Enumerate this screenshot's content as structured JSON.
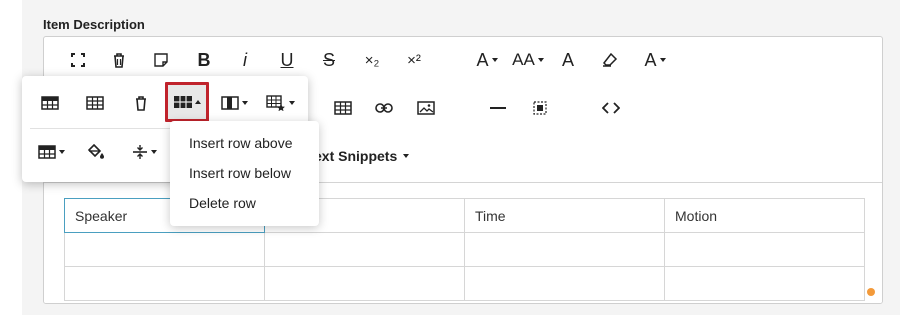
{
  "field": {
    "label": "Item Description"
  },
  "toolbar": {
    "row1": [
      {
        "name": "fullscreen-icon"
      },
      {
        "name": "trash-icon"
      },
      {
        "name": "note-icon"
      },
      {
        "name": "bold-icon",
        "text": "B"
      },
      {
        "name": "italic-icon",
        "text": "i"
      },
      {
        "name": "underline-icon",
        "text": "U"
      },
      {
        "name": "strikethrough-icon",
        "text": "S"
      },
      {
        "name": "subscript-icon",
        "text": "×₂"
      },
      {
        "name": "superscript-icon",
        "text": "×²"
      },
      {
        "name": "font-family-icon",
        "text": "A"
      },
      {
        "name": "font-size-icon",
        "text": "AA"
      },
      {
        "name": "text-color-icon",
        "text": "A"
      },
      {
        "name": "highlight-icon"
      },
      {
        "name": "text-style-icon",
        "text": "A"
      }
    ],
    "snippets_label": "ext Snippets"
  },
  "table": {
    "headers": [
      "Speaker",
      "",
      "Time",
      "Motion"
    ],
    "rows": [
      [
        "",
        "",
        "",
        ""
      ],
      [
        "",
        "",
        "",
        ""
      ]
    ]
  },
  "table_popup": {
    "dropdown_items": [
      "Insert row above",
      "Insert row below",
      "Delete row"
    ]
  },
  "colors": {
    "active_border": "#c0232c",
    "cell_focus": "#4a9fc0",
    "indicator": "#f39a3a"
  }
}
